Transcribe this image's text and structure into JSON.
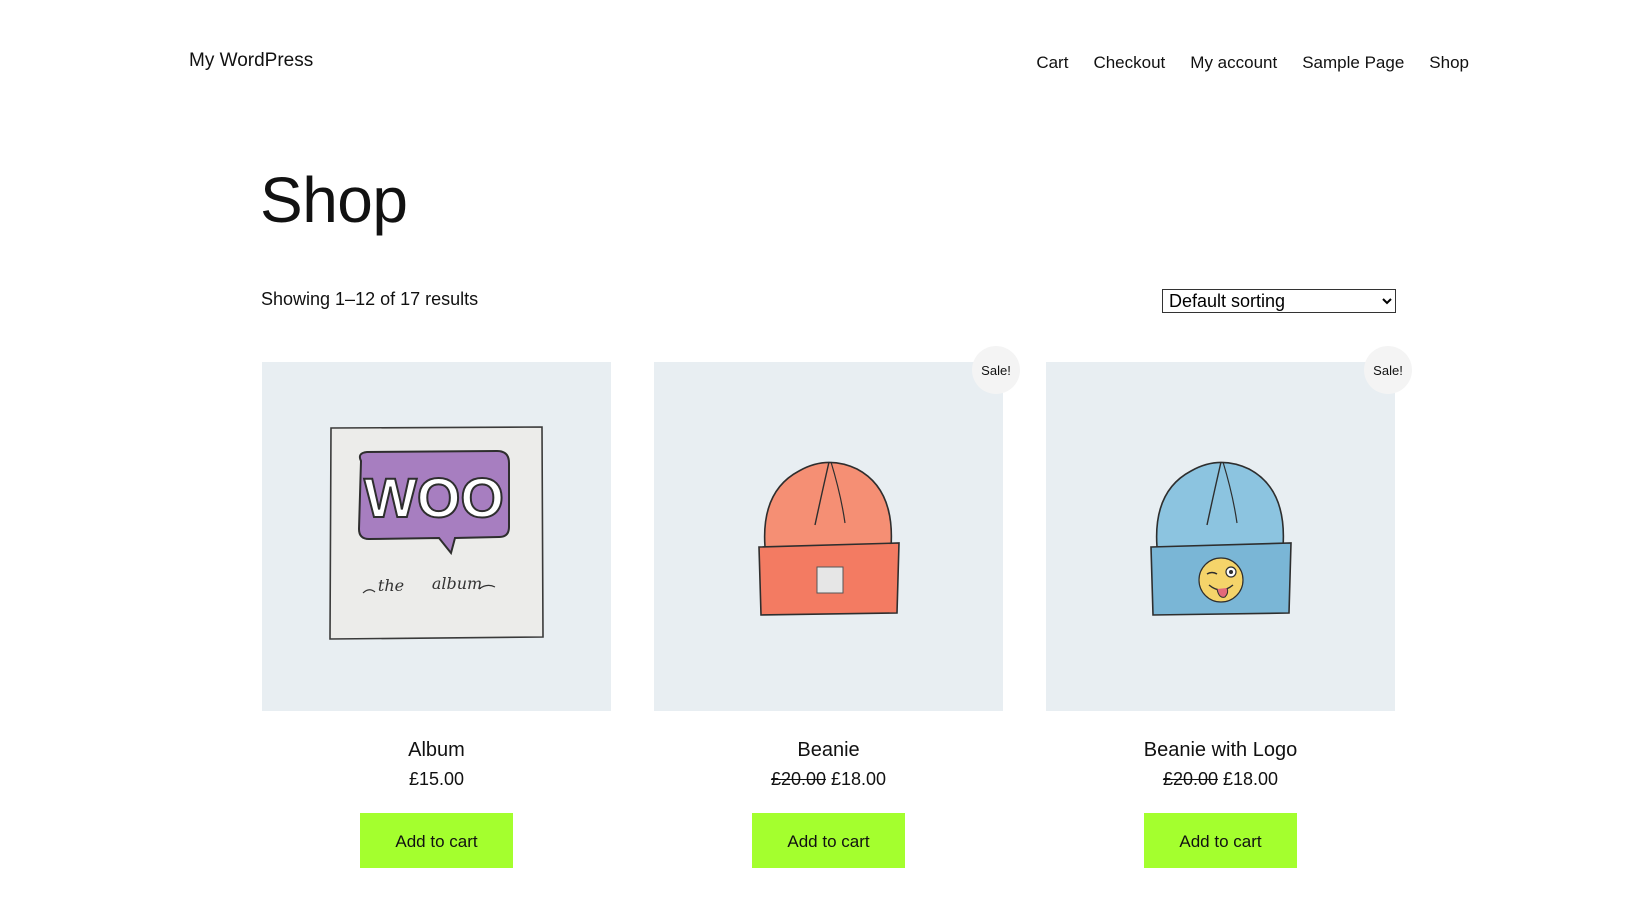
{
  "header": {
    "site_title": "My WordPress",
    "nav": [
      "Cart",
      "Checkout",
      "My account",
      "Sample Page",
      "Shop"
    ]
  },
  "main": {
    "title": "Shop",
    "result_count": "Showing 1–12 of 17 results",
    "sorting": {
      "selected": "Default sorting"
    }
  },
  "products": [
    {
      "name": "Album",
      "price": "£15.00",
      "old_price": "",
      "sale_badge": "",
      "button_label": "Add to cart",
      "image": "woo-album-image",
      "image_text": [
        "WOO",
        "the",
        "album"
      ]
    },
    {
      "name": "Beanie",
      "price": "£18.00",
      "old_price": "£20.00",
      "sale_badge": "Sale!",
      "button_label": "Add to cart",
      "image": "orange-beanie-image"
    },
    {
      "name": "Beanie with Logo",
      "price": "£18.00",
      "old_price": "£20.00",
      "sale_badge": "Sale!",
      "button_label": "Add to cart",
      "image": "blue-beanie-with-logo-image"
    }
  ],
  "colors": {
    "button_bg": "#a4ff2e",
    "thumb_bg": "#e8eef2",
    "badge_bg": "#f4f4f4",
    "orange_beanie": "#f58f74",
    "blue_beanie": "#8cc4e0",
    "album_purple": "#a77ec0"
  }
}
